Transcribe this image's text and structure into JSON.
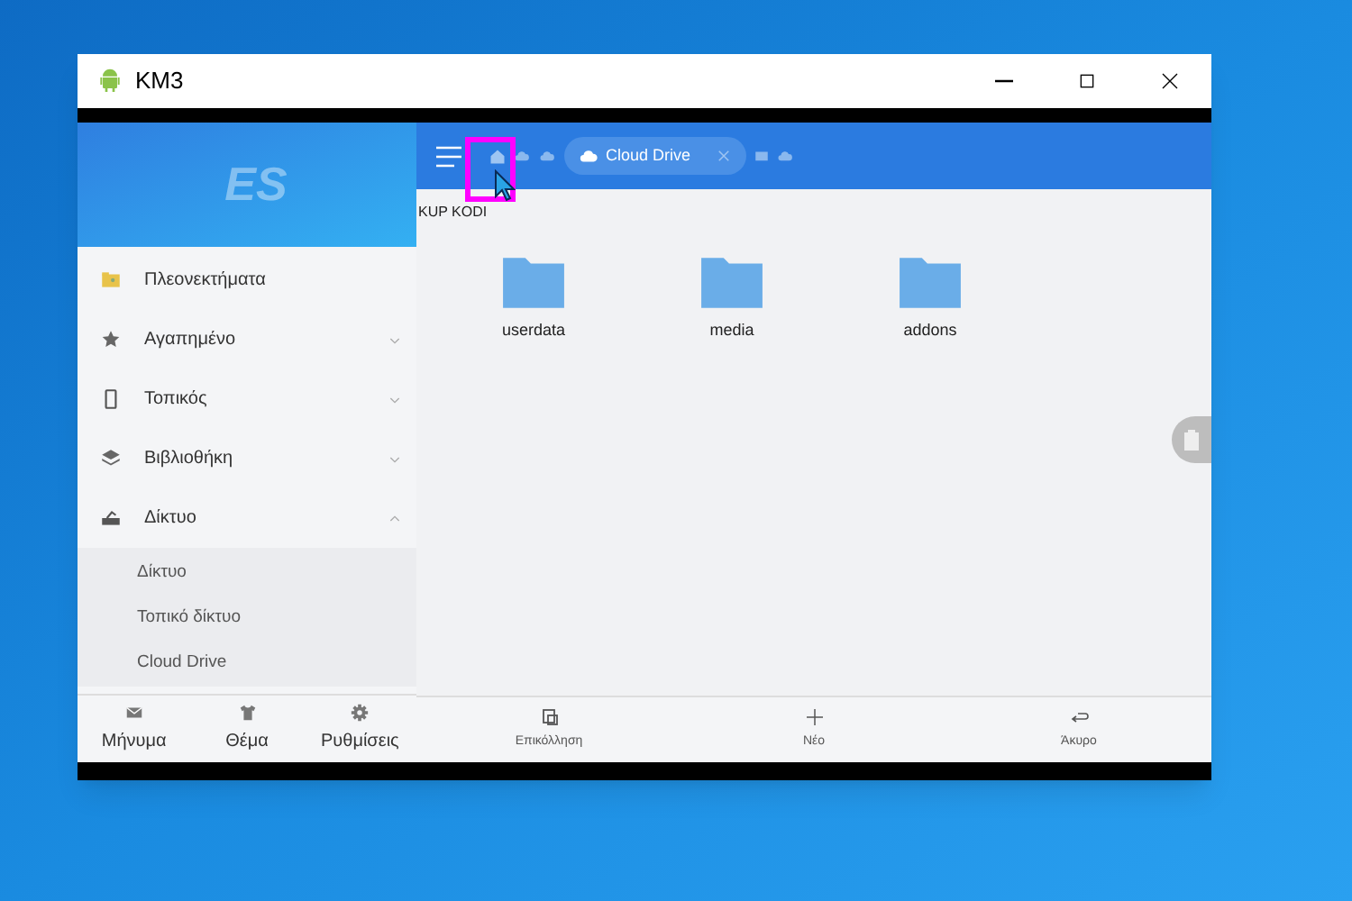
{
  "window": {
    "title": "KM3"
  },
  "sidebar": {
    "logo": "ES",
    "items": [
      {
        "label": "Πλεονεκτήματα",
        "kind": "plain"
      },
      {
        "label": "Αγαπημένο",
        "kind": "expandable",
        "expanded": false
      },
      {
        "label": "Τοπικός",
        "kind": "expandable",
        "expanded": false
      },
      {
        "label": "Βιβλιοθήκη",
        "kind": "expandable",
        "expanded": false
      },
      {
        "label": "Δίκτυο",
        "kind": "expandable",
        "expanded": true,
        "children": [
          {
            "label": "Δίκτυο"
          },
          {
            "label": "Τοπικό δίκτυο"
          },
          {
            "label": "Cloud Drive"
          }
        ]
      }
    ],
    "bottom_buttons": [
      {
        "label": "Μήνυμα"
      },
      {
        "label": "Θέμα"
      },
      {
        "label": "Ρυθμίσεις"
      }
    ]
  },
  "toolbar": {
    "breadcrumb_tab": "Cloud Drive"
  },
  "path": "KUP KODI",
  "folders": [
    {
      "name": "userdata"
    },
    {
      "name": "media"
    },
    {
      "name": "addons"
    }
  ],
  "bottom_actions": [
    {
      "label": "Επικόλληση"
    },
    {
      "label": "Νέο"
    },
    {
      "label": "Άκυρο"
    }
  ]
}
